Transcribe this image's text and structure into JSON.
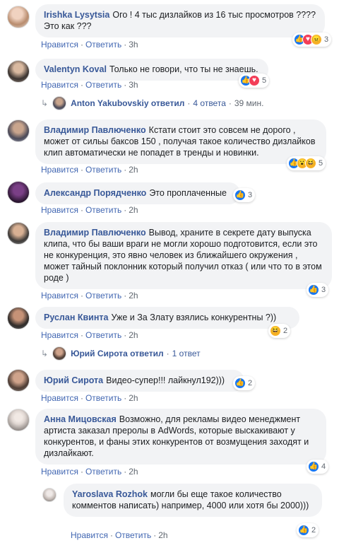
{
  "comments": [
    {
      "author": "Irishka Lysytsia",
      "text": "Ого ! 4 тыс дизлайков из 16 тыс просмотров ???? Это как ???",
      "like": "Нравится",
      "reply": "Ответить",
      "time": "3h",
      "reaction_count": "3"
    },
    {
      "author": "Valentyn Koval",
      "text": "Только не говори, что ты не знаешь.",
      "like": "Нравится",
      "reply": "Ответить",
      "time": "3h",
      "reaction_count": "5",
      "replies": {
        "name": "Anton Yakubovskiy ответил",
        "count": "4 ответа",
        "time": "39 мин."
      }
    },
    {
      "author": "Владимир Павлюченко",
      "text": "Кстати стоит это совсем не дорого , может от сильы баксов 150 , получая такое количество дизлайков клип автоматически не попадет в тренды и новинки.",
      "like": "Нравится",
      "reply": "Ответить",
      "time": "2h",
      "reaction_count": "5"
    },
    {
      "author": "Александр Порядченко",
      "text": "Это проплаченные",
      "like": "Нравится",
      "reply": "Ответить",
      "time": "2h",
      "reaction_count": "3"
    },
    {
      "author": "Владимир Павлюченко",
      "text": "Вывод, храните в секрете дату выпуска клипа, что бы ваши враги не могли хорошо подготовится, если это не конкуренция, это явно человек из ближайшего окружения , может тайный поклонник который получил отказ ( или что то в этом роде )",
      "like": "Нравится",
      "reply": "Ответить",
      "time": "2h",
      "reaction_count": "3"
    },
    {
      "author": "Руслан Квинта",
      "text": "Уже и За Злату взялись конкурентны ?))",
      "like": "Нравится",
      "reply": "Ответить",
      "time": "2h",
      "reaction_count": "2",
      "replies": {
        "name": "Юрий Сирота ответил",
        "count": "1 ответ",
        "time": ""
      }
    },
    {
      "author": "Юрий Сирота",
      "text": "Видео-супер!!! лайкнул192)))",
      "like": "Нравится",
      "reply": "Ответить",
      "time": "2h",
      "reaction_count": "2"
    },
    {
      "author": "Анна Мицовская",
      "text": "Возможно, для рекламы видео менеджмент артиста заказал преролы в AdWords, которые выскакивают у конкурентов, и фаны этих конкурентов от возмущения заходят и дизлайкают.",
      "like": "Нравится",
      "reply": "Ответить",
      "time": "2h",
      "reaction_count": "4"
    },
    {
      "author": "Yaroslava Rozhok",
      "text": "могли бы еще такое количество комментов написать) например, 4000 или хотя бы 2000)))",
      "like": "Нравится",
      "reply": "Ответить",
      "time": "2h",
      "reaction_count": "2"
    }
  ]
}
